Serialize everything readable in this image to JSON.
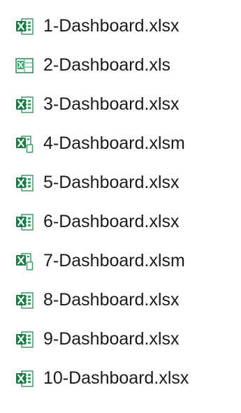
{
  "files": [
    {
      "name": "1-Dashboard.xlsx",
      "icon": "excel-xlsx-file-icon",
      "kind": "xlsx"
    },
    {
      "name": "2-Dashboard.xls",
      "icon": "excel-xls-file-icon",
      "kind": "xls"
    },
    {
      "name": "3-Dashboard.xlsx",
      "icon": "excel-xlsx-file-icon",
      "kind": "xlsx"
    },
    {
      "name": "4-Dashboard.xlsm",
      "icon": "excel-xlsm-file-icon",
      "kind": "xlsm"
    },
    {
      "name": "5-Dashboard.xlsx",
      "icon": "excel-xlsx-file-icon",
      "kind": "xlsx"
    },
    {
      "name": "6-Dashboard.xlsx",
      "icon": "excel-xlsx-file-icon",
      "kind": "xlsx"
    },
    {
      "name": "7-Dashboard.xlsm",
      "icon": "excel-xlsm-file-icon",
      "kind": "xlsm"
    },
    {
      "name": "8-Dashboard.xlsx",
      "icon": "excel-xlsx-file-icon",
      "kind": "xlsx"
    },
    {
      "name": "9-Dashboard.xlsx",
      "icon": "excel-xlsx-file-icon",
      "kind": "xlsx"
    },
    {
      "name": "10-Dashboard.xlsx",
      "icon": "excel-xlsx-file-icon",
      "kind": "xlsx"
    }
  ],
  "colors": {
    "excel_green": "#1d7a45",
    "excel_green_light": "#33a564",
    "page_white": "#ffffff",
    "text": "#1a1a1a"
  }
}
